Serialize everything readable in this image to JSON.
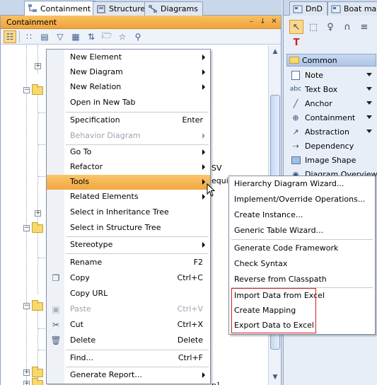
{
  "left_tabs": [
    {
      "label": "Containment",
      "active": true
    },
    {
      "label": "Structure",
      "active": false
    },
    {
      "label": "Diagrams",
      "active": false
    }
  ],
  "panel": {
    "title": "Containment",
    "title_controls": [
      "minimize",
      "pin",
      "close"
    ]
  },
  "tree_fragments": {
    "frag_sv": "SV",
    "frag_requirement": "equirement",
    "frag_p": "p]"
  },
  "palette": {
    "tabs": [
      "DnD",
      "Boat map"
    ],
    "group_label": "Common",
    "items": [
      {
        "label": "Note",
        "icon": "note-icon",
        "has_dropdown": true
      },
      {
        "label": "Text Box",
        "icon": "text-box-icon",
        "has_dropdown": true
      },
      {
        "label": "Anchor",
        "icon": "anchor-icon",
        "has_dropdown": true
      },
      {
        "label": "Containment",
        "icon": "containment-icon",
        "has_dropdown": true
      },
      {
        "label": "Abstraction",
        "icon": "abstraction-icon",
        "has_dropdown": true
      },
      {
        "label": "Dependency",
        "icon": "dependency-icon",
        "has_dropdown": false
      },
      {
        "label": "Image Shape",
        "icon": "image-shape-icon",
        "has_dropdown": false
      },
      {
        "label": "Diagram Overview",
        "icon": "diagram-overview-icon",
        "has_dropdown": false
      }
    ],
    "text_icon_label": "abc"
  },
  "context_menu": {
    "items": [
      {
        "label": "New Element",
        "shortcut": "",
        "submenu": true,
        "disabled": false,
        "icon": ""
      },
      {
        "label": "New Diagram",
        "shortcut": "",
        "submenu": true,
        "disabled": false,
        "icon": ""
      },
      {
        "label": "New Relation",
        "shortcut": "",
        "submenu": true,
        "disabled": false,
        "icon": ""
      },
      {
        "label": "Open in New Tab",
        "shortcut": "",
        "submenu": false,
        "disabled": false,
        "icon": ""
      },
      {
        "label": "Specification",
        "shortcut": "Enter",
        "submenu": false,
        "disabled": false,
        "icon": ""
      },
      {
        "label": "Behavior Diagram",
        "shortcut": "",
        "submenu": true,
        "disabled": true,
        "icon": ""
      },
      {
        "label": "Go To",
        "shortcut": "",
        "submenu": true,
        "disabled": false,
        "icon": ""
      },
      {
        "label": "Refactor",
        "shortcut": "",
        "submenu": true,
        "disabled": false,
        "icon": ""
      },
      {
        "label": "Tools",
        "shortcut": "",
        "submenu": true,
        "disabled": false,
        "icon": "",
        "highlighted": true
      },
      {
        "label": "Related Elements",
        "shortcut": "",
        "submenu": true,
        "disabled": false,
        "icon": ""
      },
      {
        "label": "Select in Inheritance Tree",
        "shortcut": "",
        "submenu": false,
        "disabled": false,
        "icon": ""
      },
      {
        "label": "Select in Structure Tree",
        "shortcut": "",
        "submenu": false,
        "disabled": false,
        "icon": ""
      },
      {
        "label": "Stereotype",
        "shortcut": "",
        "submenu": true,
        "disabled": false,
        "icon": ""
      },
      {
        "label": "Rename",
        "shortcut": "F2",
        "submenu": false,
        "disabled": false,
        "icon": ""
      },
      {
        "label": "Copy",
        "shortcut": "Ctrl+C",
        "submenu": false,
        "disabled": false,
        "icon": "copy-icon"
      },
      {
        "label": "Copy URL",
        "shortcut": "",
        "submenu": false,
        "disabled": false,
        "icon": ""
      },
      {
        "label": "Paste",
        "shortcut": "Ctrl+V",
        "submenu": false,
        "disabled": true,
        "icon": "paste-icon"
      },
      {
        "label": "Cut",
        "shortcut": "Ctrl+X",
        "submenu": false,
        "disabled": false,
        "icon": "cut-icon"
      },
      {
        "label": "Delete",
        "shortcut": "Delete",
        "submenu": false,
        "disabled": false,
        "icon": "delete-icon"
      },
      {
        "label": "Find...",
        "shortcut": "Ctrl+F",
        "submenu": false,
        "disabled": false,
        "icon": ""
      },
      {
        "label": "Generate Report...",
        "shortcut": "",
        "submenu": true,
        "disabled": false,
        "icon": ""
      }
    ]
  },
  "tools_submenu": {
    "items": [
      {
        "label": "Hierarchy Diagram Wizard..."
      },
      {
        "label": "Implement/Override Operations..."
      },
      {
        "label": "Create Instance..."
      },
      {
        "label": "Generic Table Wizard..."
      },
      {
        "label": "Generate Code Framework"
      },
      {
        "label": "Check Syntax"
      },
      {
        "label": "Reverse from Classpath"
      },
      {
        "label": "Import Data from Excel"
      },
      {
        "label": "Create Mapping"
      },
      {
        "label": "Export Data to Excel"
      }
    ]
  },
  "colors": {
    "highlight": "#f1a63f",
    "panel_title": "#f0a23c",
    "callout_box": "#d42020"
  }
}
